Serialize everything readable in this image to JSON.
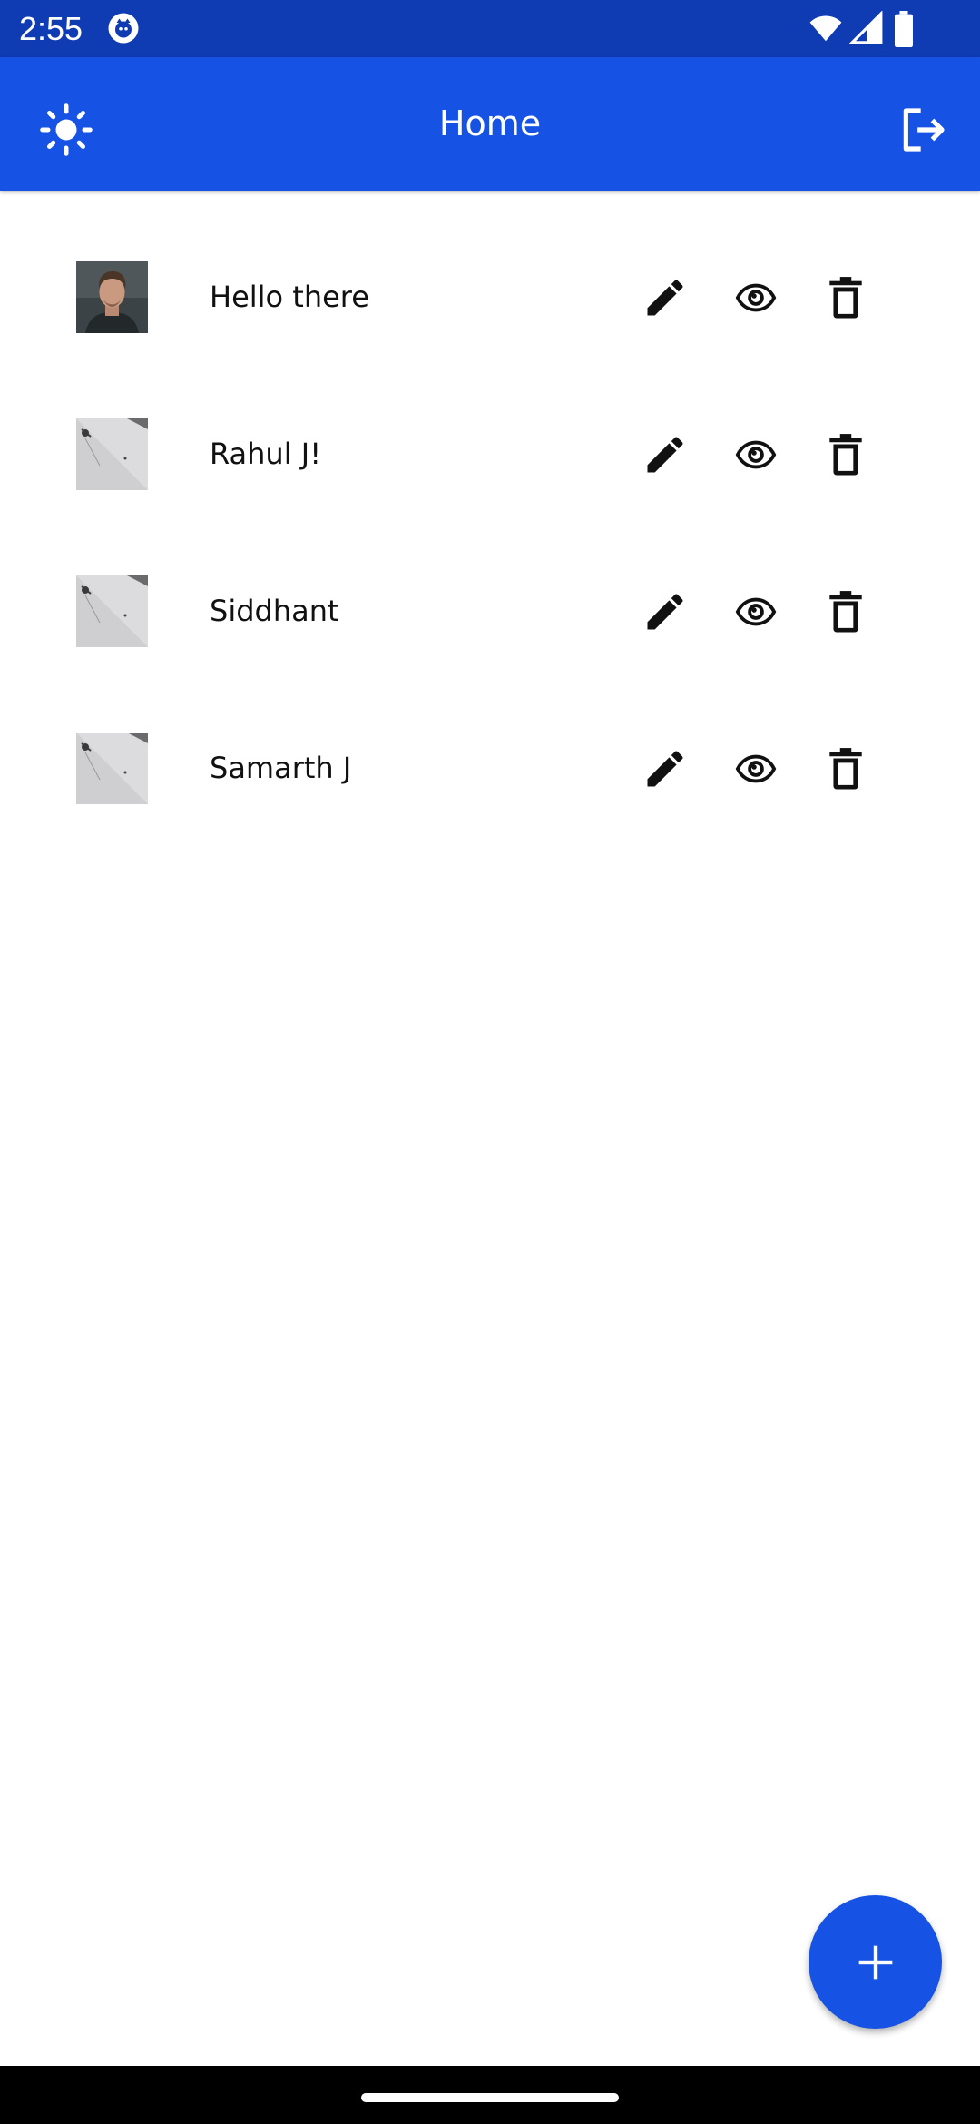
{
  "status_bar": {
    "time": "2:55",
    "icons": [
      "app-notification-icon",
      "wifi-icon",
      "signal-icon",
      "battery-icon"
    ]
  },
  "app_bar": {
    "title": "Home",
    "left_icon": "sun-icon",
    "right_icon": "logout-icon"
  },
  "items": [
    {
      "name": "Hello there",
      "thumbnail": "portrait-photo"
    },
    {
      "name": "Rahul J!",
      "thumbnail": "gray-photo"
    },
    {
      "name": "Siddhant",
      "thumbnail": "gray-photo"
    },
    {
      "name": "Samarth J",
      "thumbnail": "gray-photo"
    }
  ],
  "item_actions": [
    "pencil-icon",
    "eye-icon",
    "trash-icon"
  ],
  "fab": {
    "icon": "plus-icon"
  },
  "colors": {
    "status_bar": "#0f3bb3",
    "primary": "#1652e3",
    "text": "#111111",
    "background": "#ffffff"
  }
}
